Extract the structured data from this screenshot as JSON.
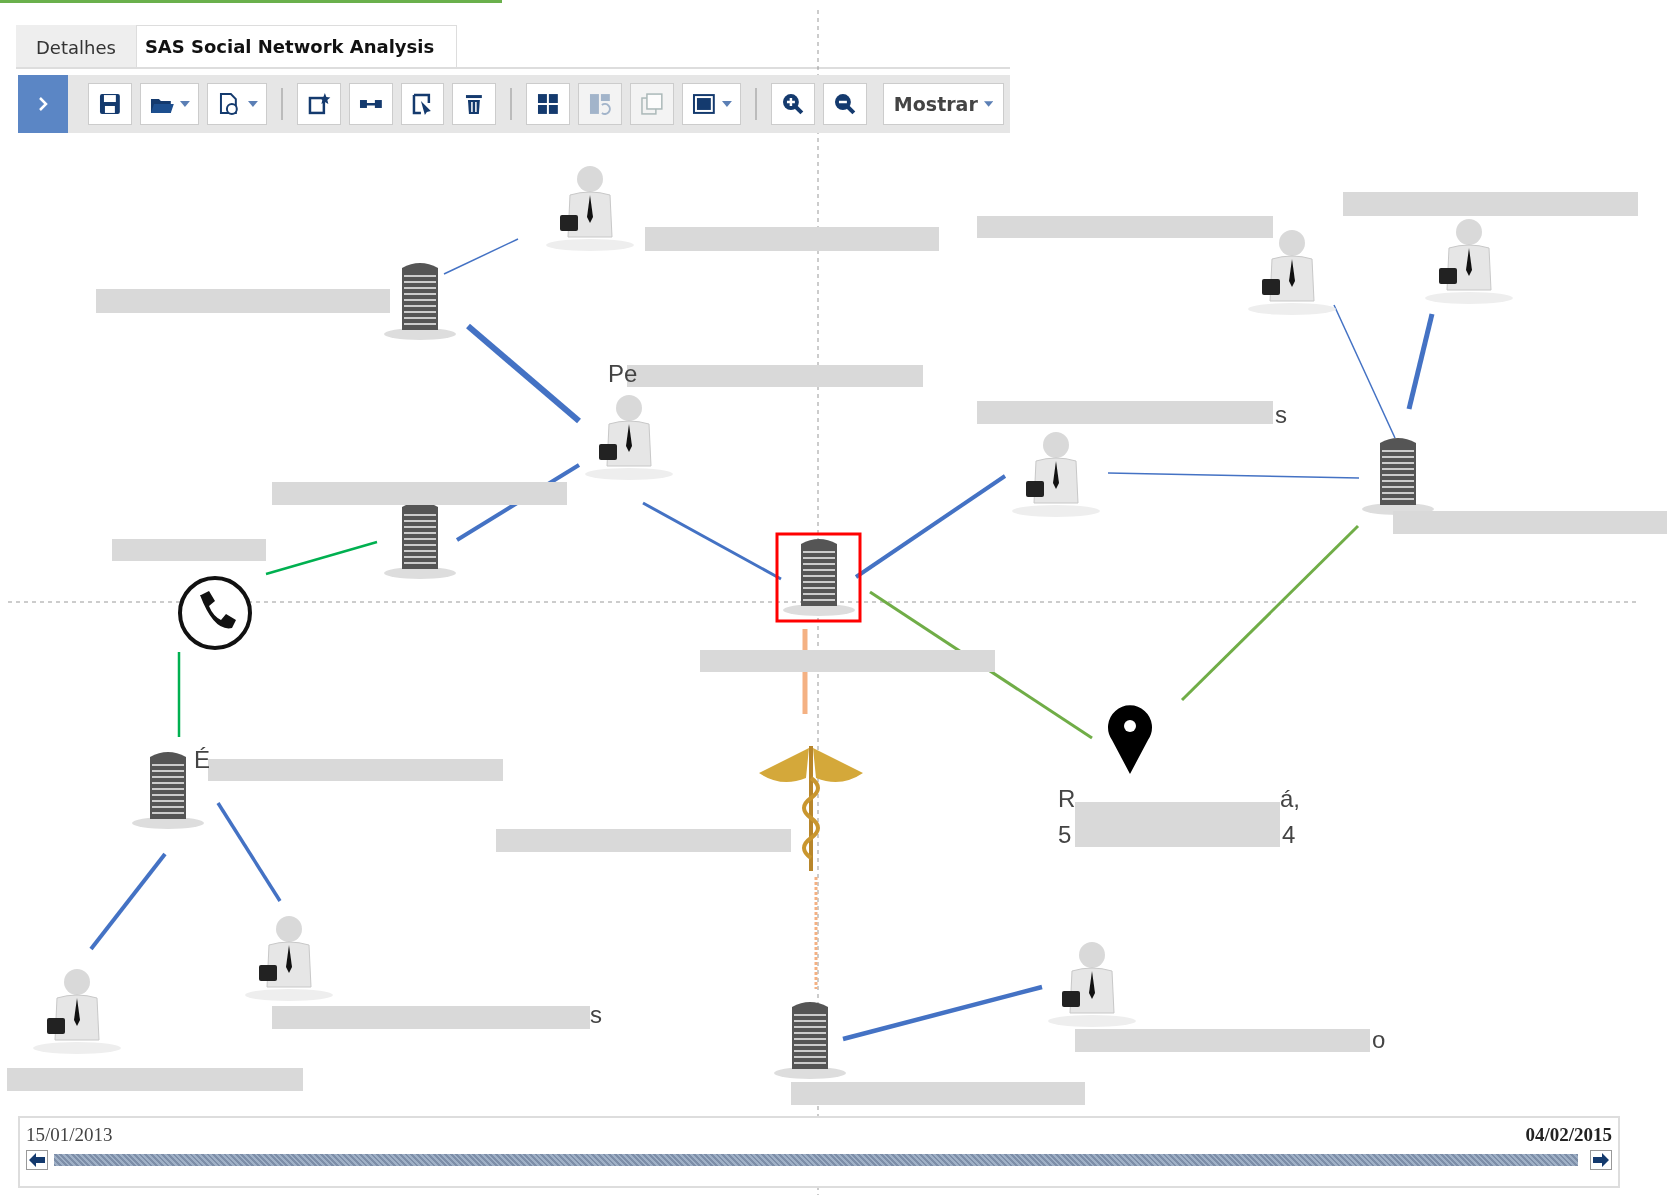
{
  "tabs": [
    {
      "label": "Detalhes",
      "selected": false
    },
    {
      "label": "SAS Social Network Analysis",
      "selected": true
    }
  ],
  "toolbar": {
    "buttons": [
      {
        "dropdown": false,
        "disabled": false
      },
      {
        "dropdown": true,
        "disabled": false
      },
      {
        "dropdown": true,
        "disabled": false
      },
      {
        "dropdown": false,
        "disabled": false
      },
      {
        "dropdown": false,
        "disabled": false
      },
      {
        "dropdown": false,
        "disabled": false
      },
      {
        "dropdown": false,
        "disabled": false
      },
      {
        "dropdown": false,
        "disabled": false
      },
      {
        "dropdown": false,
        "disabled": true
      },
      {
        "dropdown": false,
        "disabled": true
      },
      {
        "dropdown": true,
        "disabled": false
      },
      {
        "dropdown": false,
        "disabled": false
      },
      {
        "dropdown": false,
        "disabled": false
      }
    ],
    "show_menu": {
      "label": "Mostrar"
    }
  },
  "graph": {
    "nodes": [
      {
        "kind": "person",
        "selected": false
      },
      {
        "kind": "building",
        "selected": false
      },
      {
        "kind": "person",
        "selected": false
      },
      {
        "kind": "building",
        "selected": false
      },
      {
        "kind": "phone",
        "selected": false
      },
      {
        "kind": "building",
        "selected": true
      },
      {
        "kind": "person",
        "selected": false
      },
      {
        "kind": "building",
        "selected": false
      },
      {
        "kind": "person",
        "selected": false
      },
      {
        "kind": "person",
        "selected": false
      },
      {
        "kind": "pin",
        "selected": false
      },
      {
        "kind": "caduceus",
        "selected": false
      },
      {
        "kind": "building",
        "selected": false
      },
      {
        "kind": "person",
        "selected": false
      },
      {
        "kind": "person",
        "selected": false
      },
      {
        "kind": "building",
        "selected": false
      },
      {
        "kind": "person",
        "selected": false
      }
    ],
    "label_fragments": [
      "Pe",
      "s",
      "É",
      "R",
      "á,",
      "5",
      "4",
      "s",
      "o"
    ]
  },
  "timeline": {
    "start": "15/01/2013",
    "end": "04/02/2015",
    "level": 1
  }
}
